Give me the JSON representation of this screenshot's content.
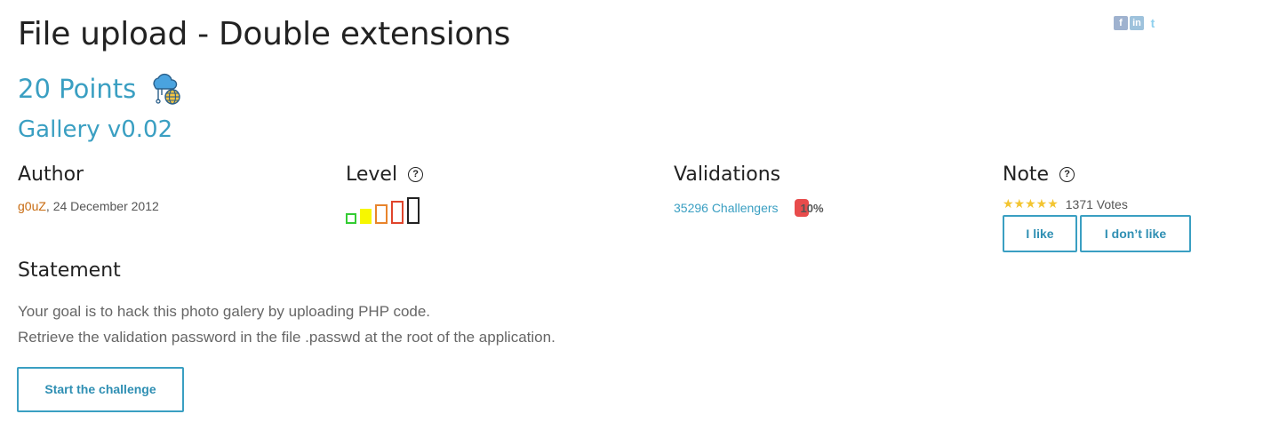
{
  "challenge": {
    "title": "File upload - Double extensions",
    "points": "20 Points",
    "category_icon": "cloud-globe-icon",
    "subtitle": "Gallery v0.02"
  },
  "social": [
    {
      "name": "facebook-icon",
      "glyph": "f"
    },
    {
      "name": "linkedin-icon",
      "glyph": "in"
    },
    {
      "name": "twitter-icon",
      "glyph": "t"
    }
  ],
  "author": {
    "heading": "Author",
    "name": "g0uZ",
    "separator": ",",
    "date": "24 December 2012"
  },
  "level": {
    "heading": "Level",
    "help_glyph": "?",
    "current": 2,
    "max": 5,
    "colors": [
      "#33cc33",
      "#f7f700",
      "#e8842c",
      "#e0452c",
      "#222222"
    ]
  },
  "validations": {
    "heading": "Validations",
    "challengers": "35296 Challengers",
    "percent": "10%",
    "bar_color": "#e84c4c"
  },
  "note": {
    "heading": "Note",
    "help_glyph": "?",
    "stars": "★★★★★",
    "rating": 5,
    "votes": "1371 Votes",
    "like_label": "I like",
    "dislike_label": "I don’t like"
  },
  "statement": {
    "heading": "Statement",
    "lines": [
      "Your goal is to hack this photo galery by uploading PHP code.",
      "Retrieve the validation password in the file .passwd at the root of the application."
    ]
  },
  "start_button": "Start the challenge",
  "colors": {
    "accent": "#3a9fc2",
    "author_link": "#c86b10",
    "star": "#f3c531"
  }
}
